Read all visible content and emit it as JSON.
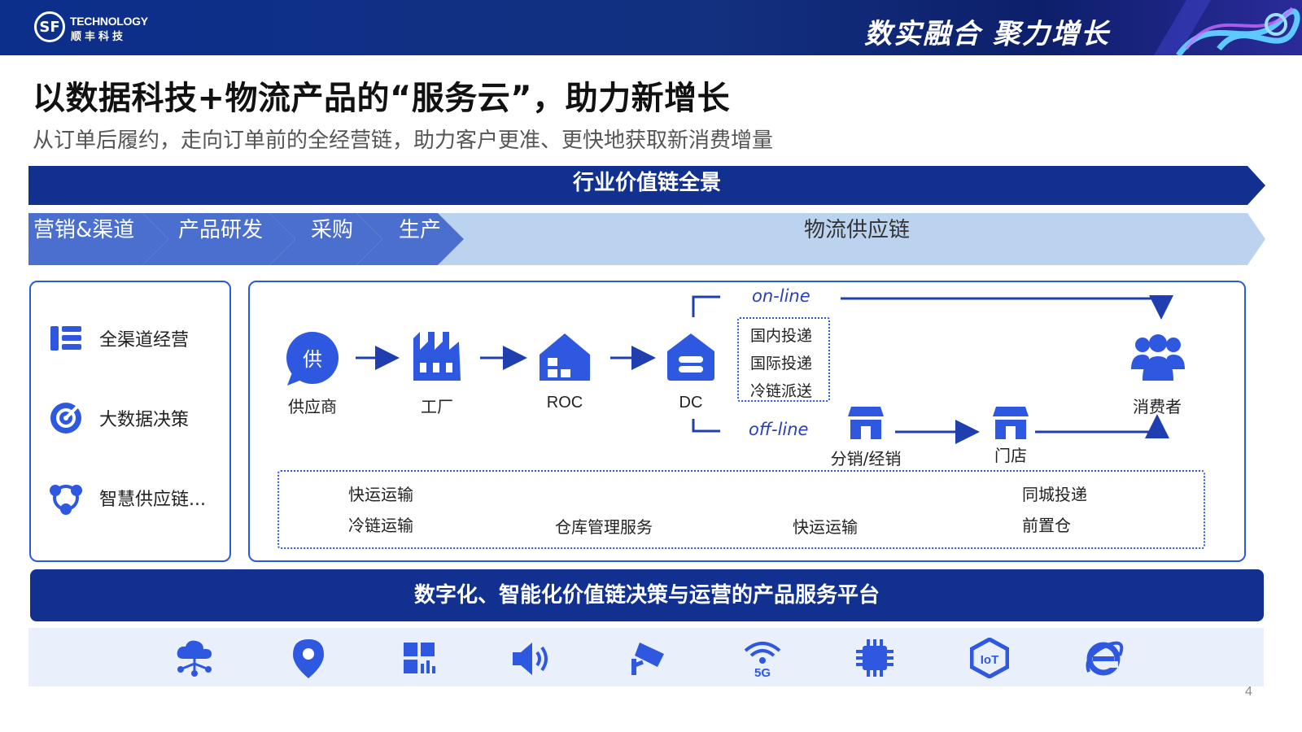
{
  "header": {
    "logo_mark": "SF",
    "logo_en": "TECHNOLOGY",
    "logo_cn": "顺丰科技",
    "slogan": "数实融合  聚力增长"
  },
  "page": {
    "title": "以数据科技+物流产品的“服务云”，助力新增长",
    "subtitle": "从订单后履约，走向订单前的全经营链，助力客户更准、更快地获取新消费增量",
    "number": "4"
  },
  "value_chain": {
    "title": "行业价值链全景",
    "stages": [
      "营销&渠道",
      "产品研发",
      "采购",
      "生产",
      "物流供应链"
    ]
  },
  "left_panel": {
    "items": [
      {
        "label": "全渠道经营",
        "icon": "list-icon"
      },
      {
        "label": "大数据决策",
        "icon": "target-icon"
      },
      {
        "label": "智慧供应链...",
        "icon": "network-icon"
      }
    ]
  },
  "flow": {
    "supplier_glyph": "供",
    "nodes": [
      "供应商",
      "工厂",
      "ROC",
      "DC",
      "消费者"
    ],
    "online_label": "on-line",
    "offline_label": "off-line",
    "delivery_options": [
      "国内投递",
      "国际投递",
      "冷链派送"
    ],
    "distribution": "分销/经销",
    "store": "门店"
  },
  "services": {
    "col1": [
      "快运运输",
      "冷链运输"
    ],
    "col2": "仓库管理服务",
    "col3": "快运运输",
    "col4": [
      "同城投递",
      "前置仓"
    ]
  },
  "platform": {
    "title": "数字化、智能化价值链决策与运营的产品服务平台",
    "icons": [
      "cloud-network-icon",
      "location-pin-icon",
      "dashboard-icon",
      "speaker-icon",
      "camera-icon",
      "5g-icon",
      "chip-icon",
      "iot-icon",
      "browser-icon"
    ],
    "badge_5g": "5G",
    "badge_iot": "IoT"
  },
  "colors": {
    "brand_dark": "#11308f",
    "accent_blue": "#2f58e0",
    "stage_blue": "#4a6fcf",
    "stage_light": "#bcd3ef"
  }
}
